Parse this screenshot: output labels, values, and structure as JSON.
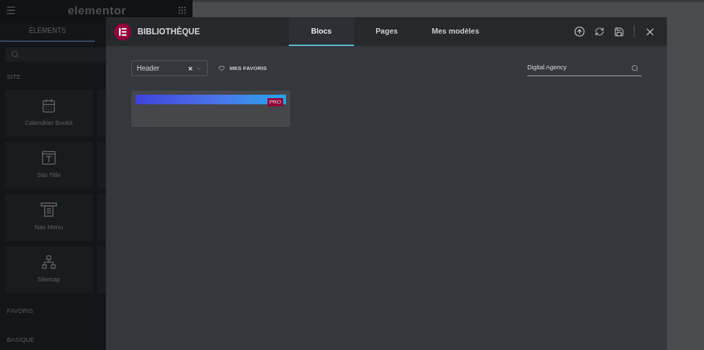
{
  "editor": {
    "logo": "elementor",
    "tab": {
      "label": "ÉLÉMENTS",
      "selected": true
    },
    "sections": [
      {
        "title": "SITE",
        "widgets": [
          {
            "label": "Calendrier Bookit"
          },
          {
            "label": "Site Title"
          },
          {
            "label": "Nav Menu"
          },
          {
            "label": "Sitemap"
          }
        ]
      },
      {
        "title": "FAVORIS"
      },
      {
        "title": "BASIQUE"
      }
    ]
  },
  "library": {
    "title": "BIBLIOTHÈQUE",
    "tabs": [
      {
        "label": "Blocs",
        "selected": true
      },
      {
        "label": "Pages",
        "selected": false
      },
      {
        "label": "Mes modèles",
        "selected": false
      }
    ],
    "filter": {
      "value": "Header"
    },
    "favorites": "MES FAVORIS",
    "search": {
      "value": "Digital Agency"
    },
    "templates": [
      {
        "badge": "PRO"
      }
    ]
  }
}
